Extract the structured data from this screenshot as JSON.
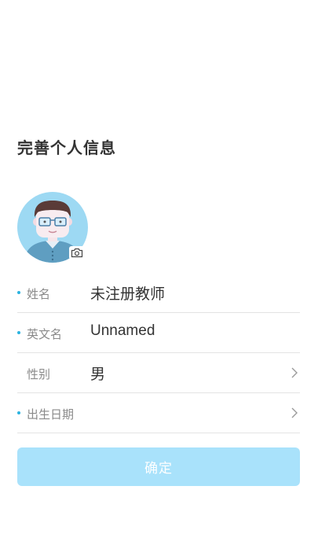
{
  "page_title": "完善个人信息",
  "avatar": {
    "icon": "teacher-avatar-icon",
    "badge_icon": "camera-icon"
  },
  "form": {
    "fields": [
      {
        "label": "姓名",
        "value": "未注册教师",
        "required": true,
        "has_arrow": false
      },
      {
        "label": "英文名",
        "value": "Unnamed",
        "required": true,
        "has_arrow": false
      },
      {
        "label": "性别",
        "value": "男",
        "required": false,
        "has_arrow": true
      },
      {
        "label": "出生日期",
        "value": "",
        "required": true,
        "has_arrow": true
      }
    ]
  },
  "confirm_button": {
    "label": "确定"
  },
  "colors": {
    "accent": "#2bb3e0",
    "button_bg": "#a9e2fb",
    "avatar_bg": "#9dd9f3"
  }
}
